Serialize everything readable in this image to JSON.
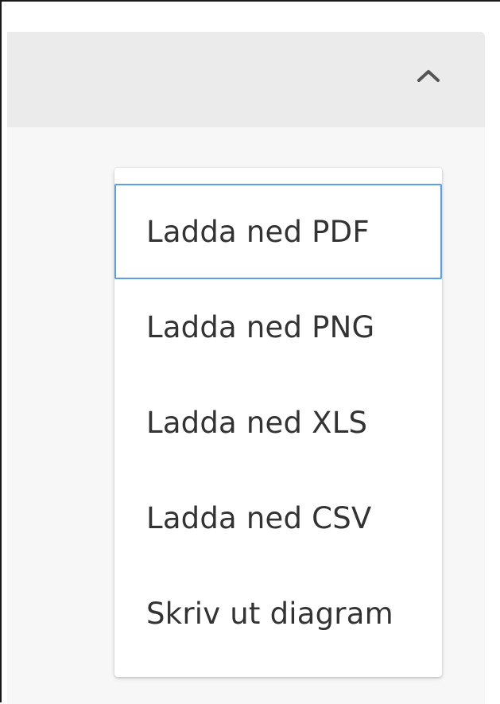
{
  "panel": {
    "collapse_icon": "chevron-up-icon"
  },
  "export_menu": {
    "items": [
      {
        "label": "Ladda ned PDF",
        "focused": true
      },
      {
        "label": "Ladda ned PNG",
        "focused": false
      },
      {
        "label": "Ladda ned XLS",
        "focused": false
      },
      {
        "label": "Ladda ned CSV",
        "focused": false
      },
      {
        "label": "Skriv ut diagram",
        "focused": false
      }
    ]
  },
  "colors": {
    "header_background": "#ebebeb",
    "panel_background": "#f7f7f7",
    "focus_ring": "#5aa0e8",
    "menu_text": "#333333"
  }
}
